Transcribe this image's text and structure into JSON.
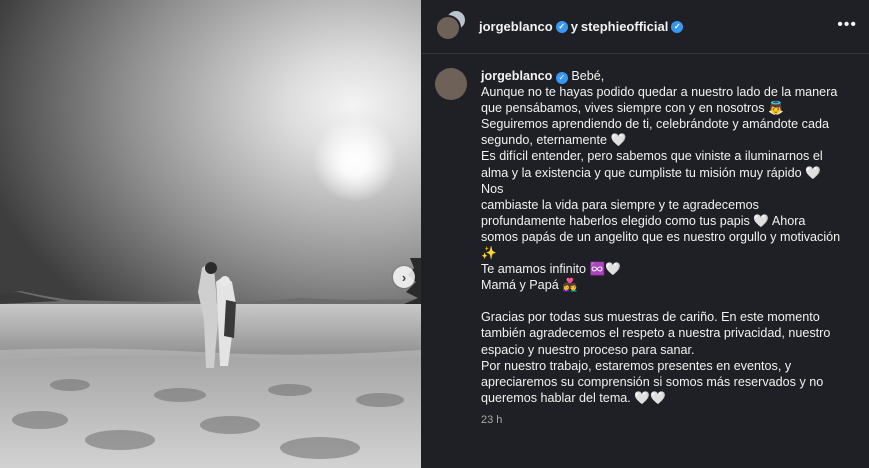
{
  "post": {
    "header": {
      "user1": "jorgeblanco",
      "joiner": "y",
      "user2": "stephieofficial",
      "more_label": "•••"
    },
    "nav": {
      "next_glyph": "›"
    },
    "caption": {
      "username": "jorgeblanco",
      "lines_a": [
        "Bebé,",
        "Aunque no te hayas podido quedar a nuestro lado de la manera",
        "que pensábamos, vives siempre con y en nosotros 👼",
        "Seguiremos aprendiendo de ti, celebrándote y amándote cada",
        "segundo, eternamente 🤍",
        "Es difícil entender, pero sabemos que viniste a iluminarnos el",
        "alma y la existencia y que cumpliste tu misión muy rápido 🤍 Nos",
        "cambiaste la vida para siempre y te agradecemos",
        "profundamente haberlos elegido como tus papis 🤍 Ahora",
        "somos papás de un angelito que es nuestro orgullo y motivación",
        "✨",
        "Te amamos infinito ♾️🤍",
        "Mamá y Papá 👩‍❤️‍👨"
      ],
      "lines_b": [
        "Gracias por todas sus muestras de cariño. En este momento",
        "también agradecemos el respeto a nuestra privacidad, nuestro",
        "espacio y nuestro proceso para sanar.",
        "Por nuestro trabajo, estaremos presentes en eventos, y",
        "apreciaremos su comprensión si somos más reservados y no",
        "queremos hablar del tema. 🤍🤍"
      ],
      "timestamp": "23 h"
    }
  },
  "colors": {
    "panel_bg": "#1f2025",
    "text": "#f2f2f2",
    "muted": "#a8a8a8",
    "verified": "#3897f0"
  }
}
